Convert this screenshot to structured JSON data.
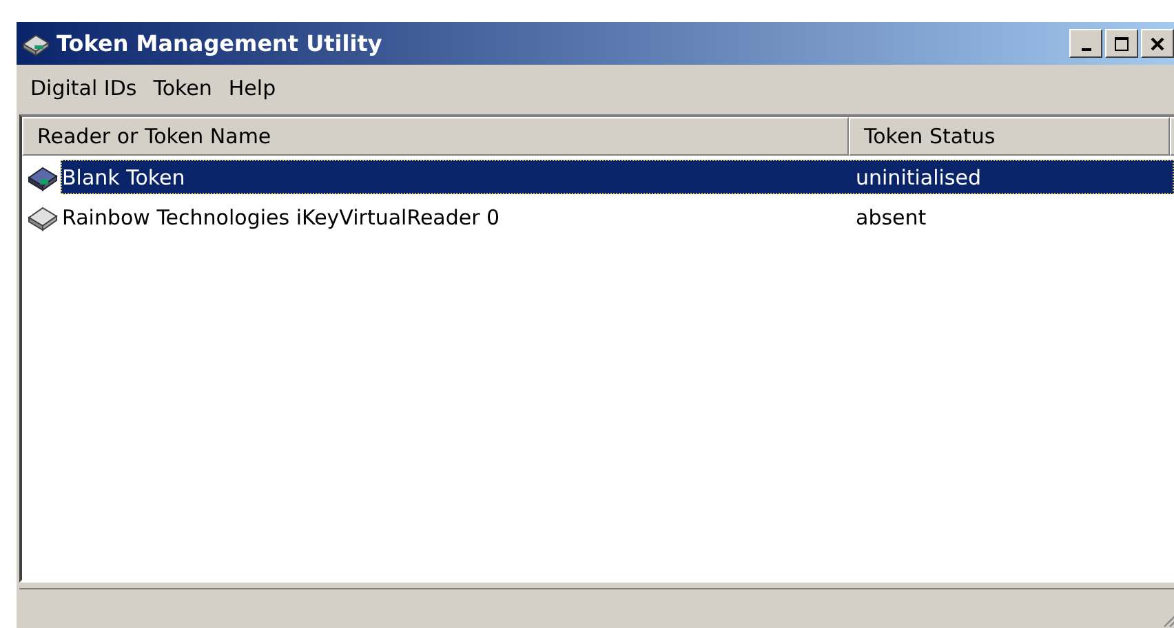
{
  "window": {
    "title": "Token Management Utility"
  },
  "menu": [
    "Digital IDs",
    "Token",
    "Help"
  ],
  "table": {
    "columns": [
      "Reader or Token Name",
      "Token Status"
    ],
    "rows": [
      {
        "kind": "token",
        "name": "Blank Token",
        "status": "uninitialised",
        "selected": true
      },
      {
        "kind": "reader",
        "name": "Rainbow Technologies iKeyVirtualReader 0",
        "status": "absent",
        "selected": false
      }
    ]
  }
}
